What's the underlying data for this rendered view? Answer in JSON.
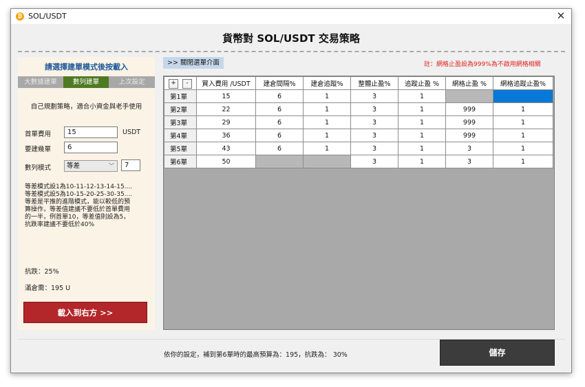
{
  "window": {
    "title": "SOL/USDT",
    "app_icon": "bitcoin-icon",
    "close_glyph": "✕"
  },
  "header": {
    "title": "貨幣對 SOL/USDT  交易策略"
  },
  "left": {
    "heading": "請選擇建單模式後按載入",
    "tabs": [
      {
        "label": "大數據建單",
        "active": false
      },
      {
        "label": "數列建單",
        "active": true
      },
      {
        "label": "上次設定",
        "active": false
      }
    ],
    "description": "自己規劃策略，適合小資金與老手使用",
    "fields": {
      "first_cost_label": "首單費用",
      "first_cost_value": "15",
      "first_cost_unit": "USDT",
      "orders_label": "要建幾單",
      "orders_value": "6",
      "sequence_label": "數列模式",
      "sequence_value": "等差",
      "sequence_step": "7"
    },
    "notes": [
      "等差模式設1為10-11-12-13-14-15....",
      "等差模式設5為10-15-20-25-30-35....",
      "等差是平推的進階模式，能以較低的預",
      "算操作，等差值建議不要低於首單費用",
      "的一半，例首單10，等差值則設為5，",
      "抗跌率建議不要低於40%"
    ],
    "drop_resistance": "抗跌：25%",
    "full_position": "滿倉需：195 U",
    "load_button": "載入到右方 >>"
  },
  "toggle_button": ">> 關閉選單介面",
  "note": "註：網格止盈設為999%為不啟用網格相關",
  "grid": {
    "corner_buttons": [
      "+",
      "-"
    ],
    "columns": [
      "買入費用 /USDT",
      "建倉間隔%",
      "建倉追蹤%",
      "整體止盈%",
      "追蹤止盈 %",
      "網格止盈 %",
      "網格追蹤止盈%"
    ],
    "rows": [
      {
        "label": "第1單",
        "cells": [
          "15",
          "6",
          "1",
          "3",
          "1",
          "",
          ""
        ]
      },
      {
        "label": "第2單",
        "cells": [
          "22",
          "6",
          "1",
          "3",
          "1",
          "999",
          "1"
        ]
      },
      {
        "label": "第3單",
        "cells": [
          "29",
          "6",
          "1",
          "3",
          "1",
          "999",
          "1"
        ]
      },
      {
        "label": "第4單",
        "cells": [
          "36",
          "6",
          "1",
          "3",
          "1",
          "999",
          "1"
        ]
      },
      {
        "label": "第5單",
        "cells": [
          "43",
          "6",
          "1",
          "3",
          "1",
          "3",
          "1"
        ]
      },
      {
        "label": "第6單",
        "cells": [
          "50",
          "",
          "",
          "3",
          "1",
          "3",
          "1"
        ]
      }
    ]
  },
  "summary": "依你的設定，補到第6單時的最高預算為：195，抗跌為： 30%",
  "save_button": "儲存"
}
